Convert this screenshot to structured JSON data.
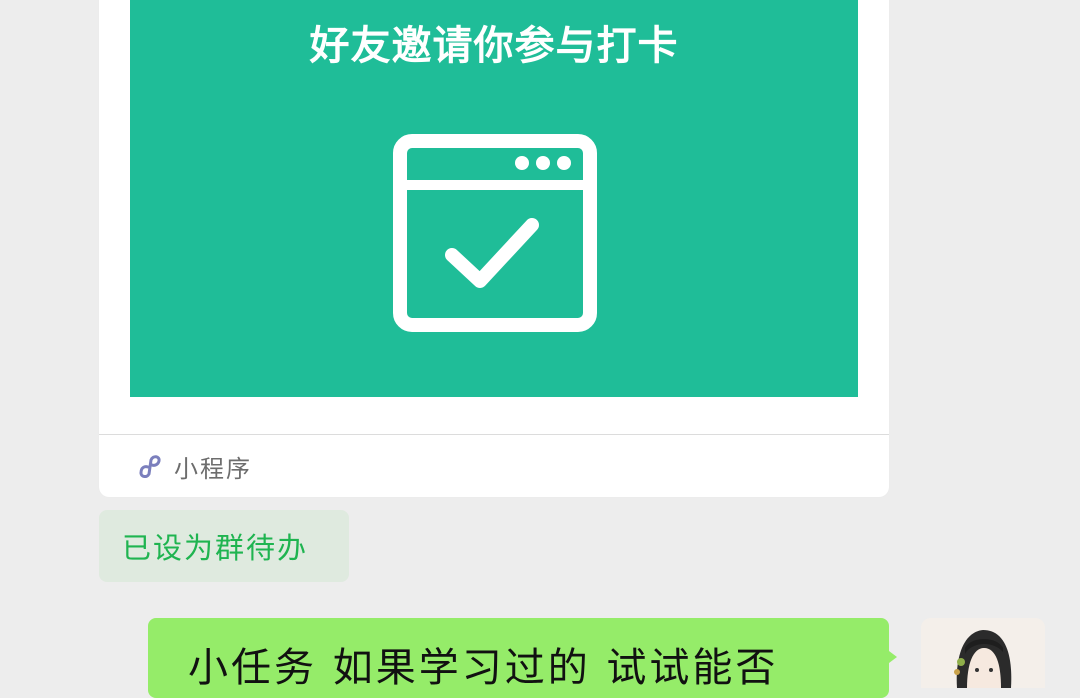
{
  "mini_program_card": {
    "cover_title": "好友邀请你参与打卡",
    "cover_icon": "calendar-check-icon",
    "footer_icon": "mini-program-icon",
    "footer_label": "小程序",
    "cover_color": "#1fbd98"
  },
  "todo_notice": {
    "text": "已设为群待办"
  },
  "message": {
    "text": "小任务 如果学习过的 试试能否",
    "bubble_color": "#95ec69"
  },
  "avatar": {
    "icon": "user-avatar"
  }
}
